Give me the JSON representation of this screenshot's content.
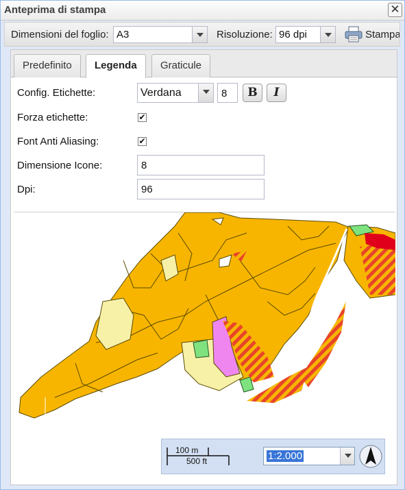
{
  "window": {
    "title": "Anteprima di stampa",
    "close_symbol": "✕"
  },
  "toolbar": {
    "sheet_label": "Dimensioni del foglio:",
    "sheet_value": "A3",
    "resolution_label": "Risoluzione:",
    "resolution_value": "96 dpi",
    "print_label": "Stampa",
    "print_icon": "printer-icon"
  },
  "tabs": [
    {
      "label": "Predefinito",
      "active": false
    },
    {
      "label": "Legenda",
      "active": true
    },
    {
      "label": "Graticule",
      "active": false
    }
  ],
  "legend_form": {
    "label_config": "Config. Etichette:",
    "font_value": "Verdana",
    "font_size": "8",
    "bold_label": "B",
    "italic_label": "I",
    "force_labels": "Forza etichette:",
    "force_labels_checked": true,
    "anti_aliasing": "Font Anti Aliasing:",
    "anti_aliasing_checked": true,
    "icon_size_label": "Dimensione Icone:",
    "icon_size_value": "8",
    "dpi_label": "Dpi:",
    "dpi_value": "96"
  },
  "map": {
    "scale_m": "100 m",
    "scale_ft": "500 ft",
    "scale_value": "1:2.000",
    "north_icon": "north-arrow-icon",
    "colors": {
      "urban": "#f7b500",
      "light": "#f7f1a8",
      "pink": "#ef86f0",
      "green": "#7fe27f",
      "red": "#e0001b",
      "hatch_red": "#e8442a"
    }
  }
}
